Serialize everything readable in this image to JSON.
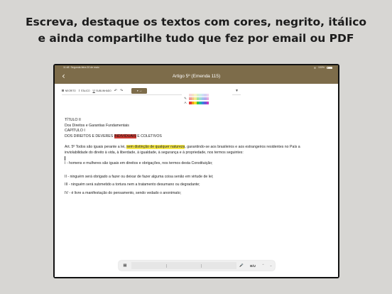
{
  "headline": {
    "line1": "Escreva, destaque os textos com cores, negrito, itálico",
    "line2": "e ainda compartilhe tudo que fez por email ou PDF"
  },
  "status": {
    "time": "11:48",
    "date": "Segunda-feira 20 de maio",
    "battery": "100%"
  },
  "nav": {
    "title": "Artigo 5º (Emenda 115)"
  },
  "toolbar": {
    "bold_label": "NEGRITO",
    "italic_label": "ITÁLICO",
    "underline_label": "SUBLINHADO"
  },
  "palette": {
    "row1": [
      "#f6d6d6",
      "#f6e2c6",
      "#f6f3c4",
      "#d8f2cc",
      "#cdeee9",
      "#cfe0f5",
      "#d6d3f3",
      "#efd3ee"
    ],
    "row2": [
      "#ef9a9a",
      "#f3c38a",
      "#f2ec8a",
      "#a6e39a",
      "#9cdcd3",
      "#9fc1ee",
      "#b3aceb",
      "#e3a9e0"
    ],
    "row3": [
      "#e53935",
      "#f39c12",
      "#f1e02a",
      "#43c03a",
      "#1fb8a8",
      "#3b82e0",
      "#6a5ad8",
      "#c13fc0"
    ]
  },
  "colors": {
    "brand": "#7d6c4a",
    "highlight_red": "#cc3b33",
    "highlight_yellow": "#f5e84a"
  },
  "document": {
    "title_line": "TÍTULO II",
    "subtitle_line": "Dos Direitos e Garantias Fundamentais",
    "chapter_line": "CAPÍTULO I",
    "chapter_name_pre": "DOS DIREITOS E DEVERES ",
    "chapter_name_hl": "INDIVIDUAIS",
    "chapter_name_post": " E COLETIVOS",
    "art_pre": "Art. 5º Todos são iguais perante a lei, ",
    "art_hl": "sem distinção de qualquer natureza",
    "art_post": ", garantindo-se aos brasileiros e aos estrangeiros residentes no País a",
    "art_line2": "inviolabilidade do direito à vida, à liberdade, à igualdade, à segurança e à propriedade, nos termos seguintes:",
    "item1": "I - homens e mulheres são iguais em direitos e obrigações, nos termos desta Constituição;",
    "item2": "II - ninguém será obrigado a fazer ou deixar de fazer alguma coisa senão em virtude de lei;",
    "item3": "III - ninguém será submetido a tortura nem a tratamento desumano ou degradante;",
    "item4": "IV - é livre a manifestação do pensamento, sendo vedado o anonimato;"
  },
  "keyboard": {
    "biu_label": "B/U"
  }
}
